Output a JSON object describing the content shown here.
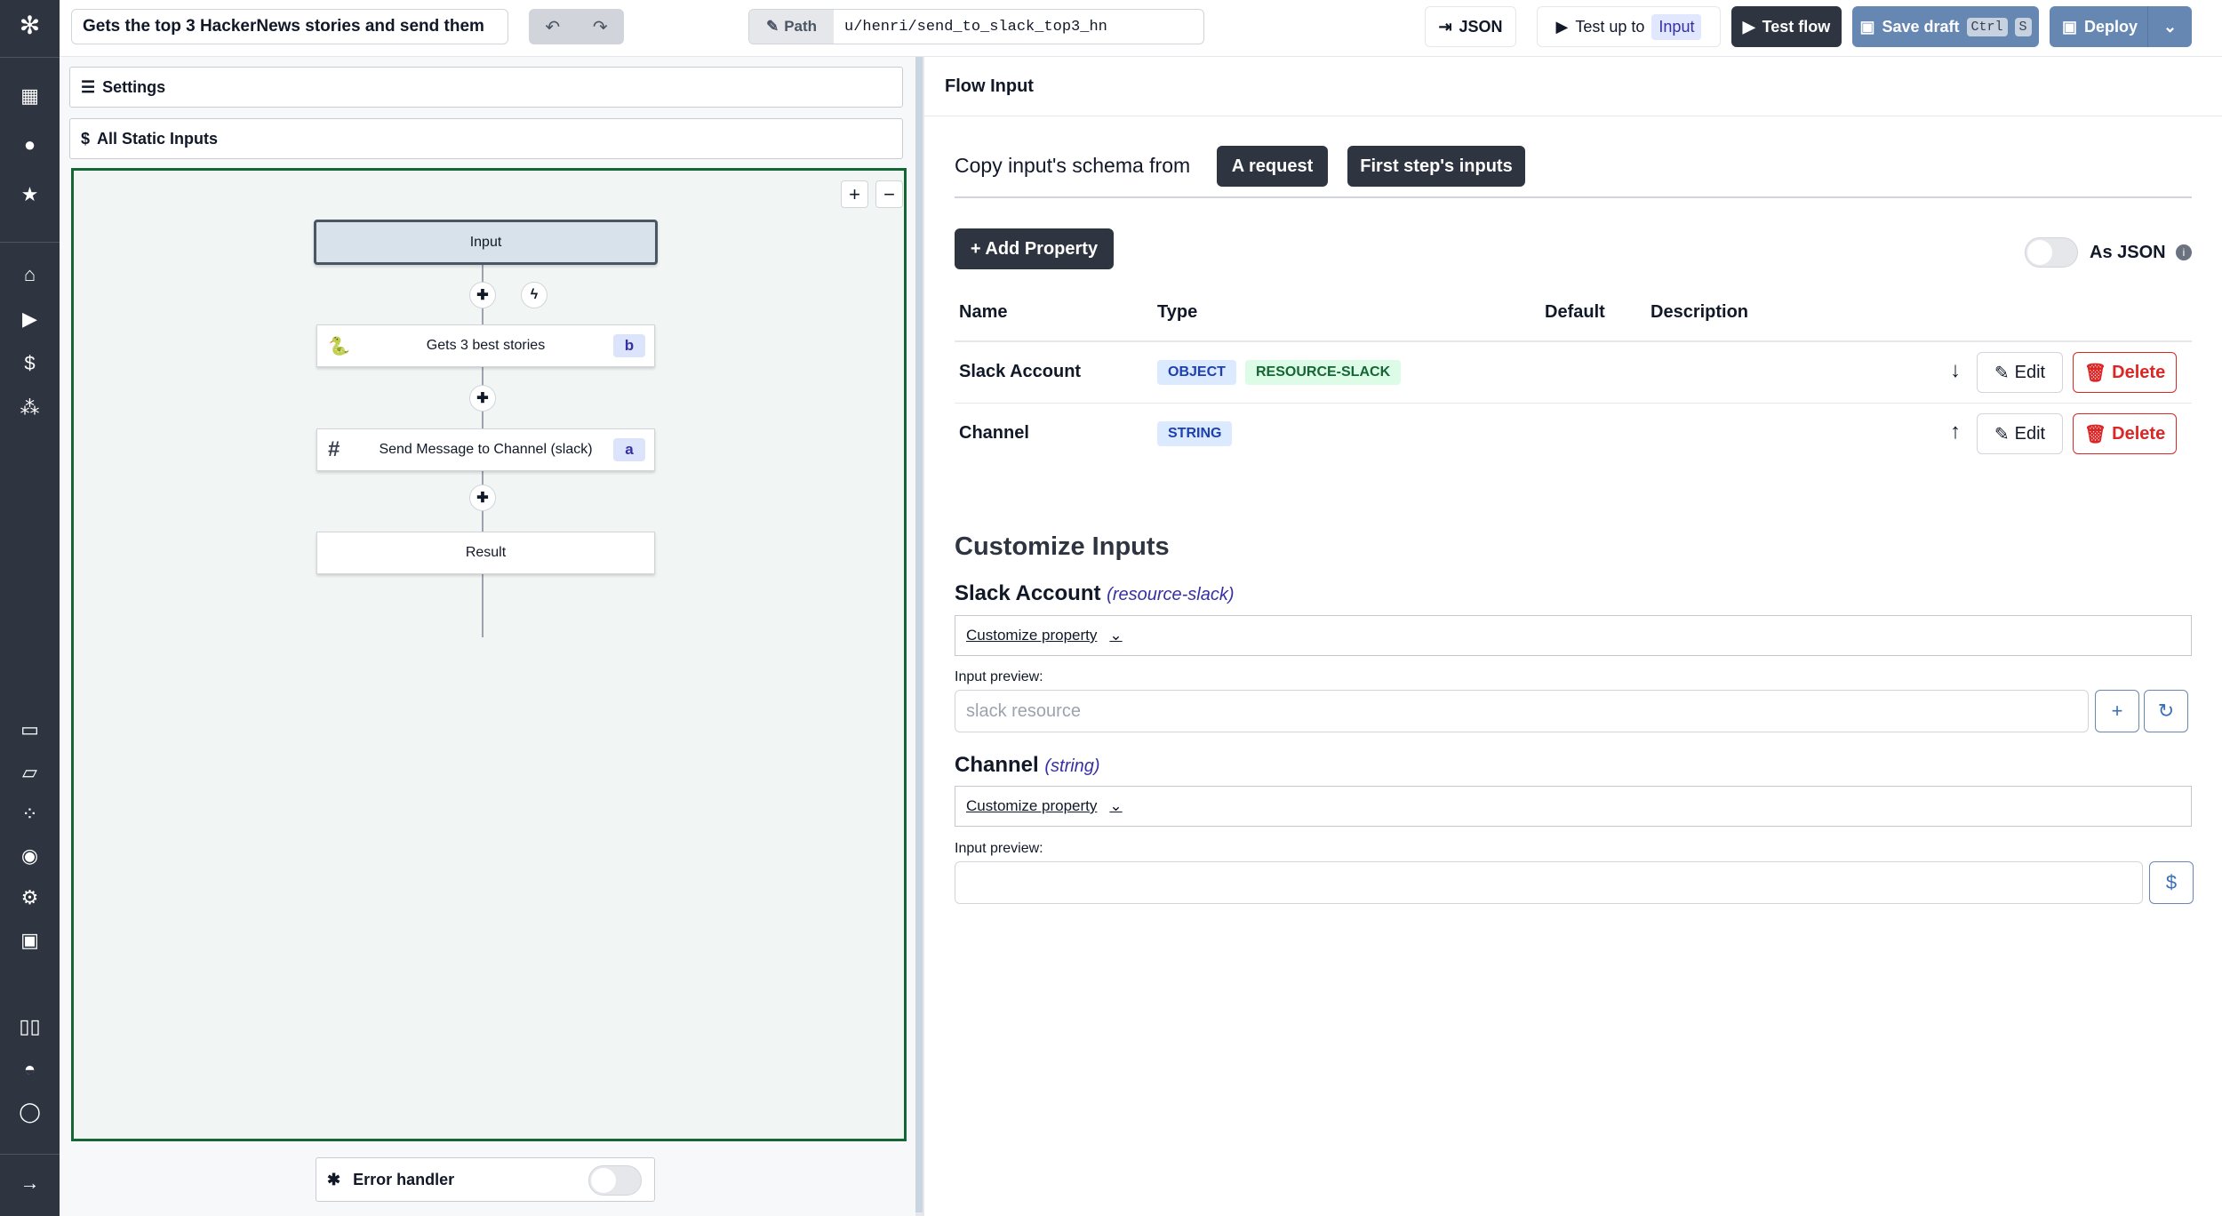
{
  "topbar": {
    "flow_summary": "Gets the top 3 HackerNews stories and send them",
    "path_label": "Path",
    "path_value": "u/henri/send_to_slack_top3_hn",
    "json_label": "JSON",
    "test_up_to_label": "Test up to",
    "test_up_to_target": "Input",
    "test_flow_label": "Test flow",
    "save_draft_label": "Save draft",
    "save_kbd_ctrl": "Ctrl",
    "save_kbd_key": "S",
    "deploy_label": "Deploy"
  },
  "left": {
    "settings_label": "Settings",
    "static_inputs_label": "All Static Inputs",
    "zoom_in": "+",
    "zoom_out": "−",
    "nodes": [
      {
        "label": "Input"
      },
      {
        "label": "Gets 3 best stories",
        "id": "b",
        "icon": "python-icon"
      },
      {
        "label": "Send Message to Channel (slack)",
        "id": "a",
        "icon": "slack-icon"
      },
      {
        "label": "Result"
      }
    ],
    "error_handler_label": "Error handler",
    "error_handler_enabled": false
  },
  "right": {
    "title": "Flow Input",
    "copy_schema_label": "Copy input's schema from",
    "copy_options": [
      "A request",
      "First step's inputs"
    ],
    "add_property_label": "+ Add Property",
    "as_json_label": "As JSON",
    "as_json_enabled": false,
    "columns": [
      "Name",
      "Type",
      "Default",
      "Description"
    ],
    "rows": [
      {
        "name": "Slack Account",
        "types": [
          "OBJECT",
          "RESOURCE-SLACK"
        ],
        "move": "↓",
        "edit": "Edit",
        "delete": "Delete"
      },
      {
        "name": "Channel",
        "types": [
          "STRING"
        ],
        "move": "↑",
        "edit": "Edit",
        "delete": "Delete"
      }
    ],
    "customize_title": "Customize Inputs",
    "customize": [
      {
        "name": "Slack Account",
        "type": "(resource-slack)",
        "select": "Customize property",
        "preview_label": "Input preview:",
        "placeholder": "slack resource"
      },
      {
        "name": "Channel",
        "type": "(string)",
        "select": "Customize property",
        "preview_label": "Input preview:",
        "placeholder": ""
      }
    ]
  },
  "colors": {
    "sidebar": "#2e3440",
    "canvas_border": "#166534",
    "primary_dark": "#2e3440",
    "save_blue": "#6787b3",
    "danger": "#dc2626"
  }
}
